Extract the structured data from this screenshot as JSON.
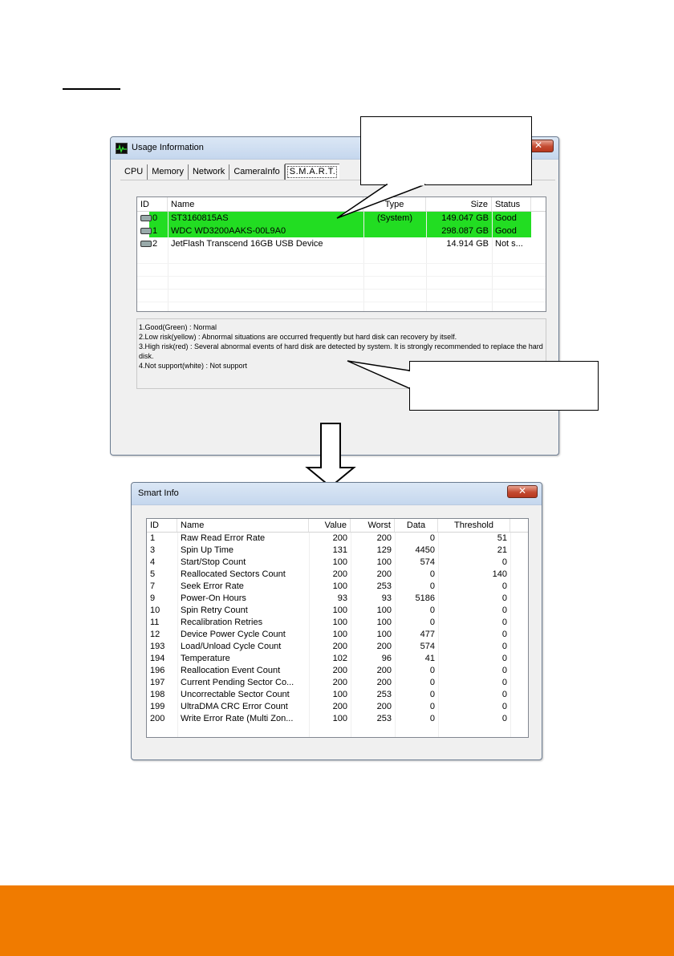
{
  "usage_window": {
    "title": "Usage Information",
    "close_label": "✕",
    "tabs": [
      "CPU",
      "Memory",
      "Network",
      "CameraInfo",
      "S.M.A.R.T."
    ],
    "active_tab": "S.M.A.R.T.",
    "columns": [
      "ID",
      "Name",
      "Type",
      "Size",
      "Status"
    ],
    "disks": [
      {
        "id": "0",
        "name": "ST3160815AS",
        "type": "(System)",
        "size": "149.047 GB",
        "status": "Good"
      },
      {
        "id": "1",
        "name": "WDC WD3200AAKS-00L9A0",
        "type": "",
        "size": "298.087 GB",
        "status": "Good"
      },
      {
        "id": "2",
        "name": "JetFlash Transcend 16GB USB Device",
        "type": "",
        "size": "14.914 GB",
        "status": "Not s..."
      }
    ],
    "legend": [
      "1.Good(Green) : Normal",
      "2.Low risk(yellow) : Abnormal situations are occurred frequently but hard disk can recovery by itself.",
      "3.High risk(red) : Several abnormal events of hard disk are detected by system. It is strongly recommended to replace the hard disk.",
      "4.Not support(white) : Not support"
    ]
  },
  "smart_window": {
    "title": "Smart Info",
    "close_label": "✕",
    "columns": [
      "ID",
      "Name",
      "Value",
      "Worst",
      "Data",
      "Threshold"
    ],
    "rows": [
      {
        "id": "1",
        "name": "Raw Read Error Rate",
        "value": "200",
        "worst": "200",
        "data": "0",
        "threshold": "51"
      },
      {
        "id": "3",
        "name": "Spin Up Time",
        "value": "131",
        "worst": "129",
        "data": "4450",
        "threshold": "21"
      },
      {
        "id": "4",
        "name": "Start/Stop Count",
        "value": "100",
        "worst": "100",
        "data": "574",
        "threshold": "0"
      },
      {
        "id": "5",
        "name": "Reallocated Sectors Count",
        "value": "200",
        "worst": "200",
        "data": "0",
        "threshold": "140"
      },
      {
        "id": "7",
        "name": "Seek Error Rate",
        "value": "100",
        "worst": "253",
        "data": "0",
        "threshold": "0"
      },
      {
        "id": "9",
        "name": "Power-On Hours",
        "value": "93",
        "worst": "93",
        "data": "5186",
        "threshold": "0"
      },
      {
        "id": "10",
        "name": "Spin Retry Count",
        "value": "100",
        "worst": "100",
        "data": "0",
        "threshold": "0"
      },
      {
        "id": "11",
        "name": "Recalibration Retries",
        "value": "100",
        "worst": "100",
        "data": "0",
        "threshold": "0"
      },
      {
        "id": "12",
        "name": "Device Power Cycle Count",
        "value": "100",
        "worst": "100",
        "data": "477",
        "threshold": "0"
      },
      {
        "id": "193",
        "name": "Load/Unload Cycle Count",
        "value": "200",
        "worst": "200",
        "data": "574",
        "threshold": "0"
      },
      {
        "id": "194",
        "name": "Temperature",
        "value": "102",
        "worst": "96",
        "data": "41",
        "threshold": "0"
      },
      {
        "id": "196",
        "name": "Reallocation Event Count",
        "value": "200",
        "worst": "200",
        "data": "0",
        "threshold": "0"
      },
      {
        "id": "197",
        "name": "Current Pending Sector Co...",
        "value": "200",
        "worst": "200",
        "data": "0",
        "threshold": "0"
      },
      {
        "id": "198",
        "name": "Uncorrectable Sector Count",
        "value": "100",
        "worst": "253",
        "data": "0",
        "threshold": "0"
      },
      {
        "id": "199",
        "name": "UltraDMA CRC Error Count",
        "value": "200",
        "worst": "200",
        "data": "0",
        "threshold": "0"
      },
      {
        "id": "200",
        "name": "Write Error Rate (Multi Zon...",
        "value": "100",
        "worst": "253",
        "data": "0",
        "threshold": "0"
      }
    ]
  },
  "colors": {
    "good_highlight": "#22dd22",
    "footer": "#f07b00"
  }
}
